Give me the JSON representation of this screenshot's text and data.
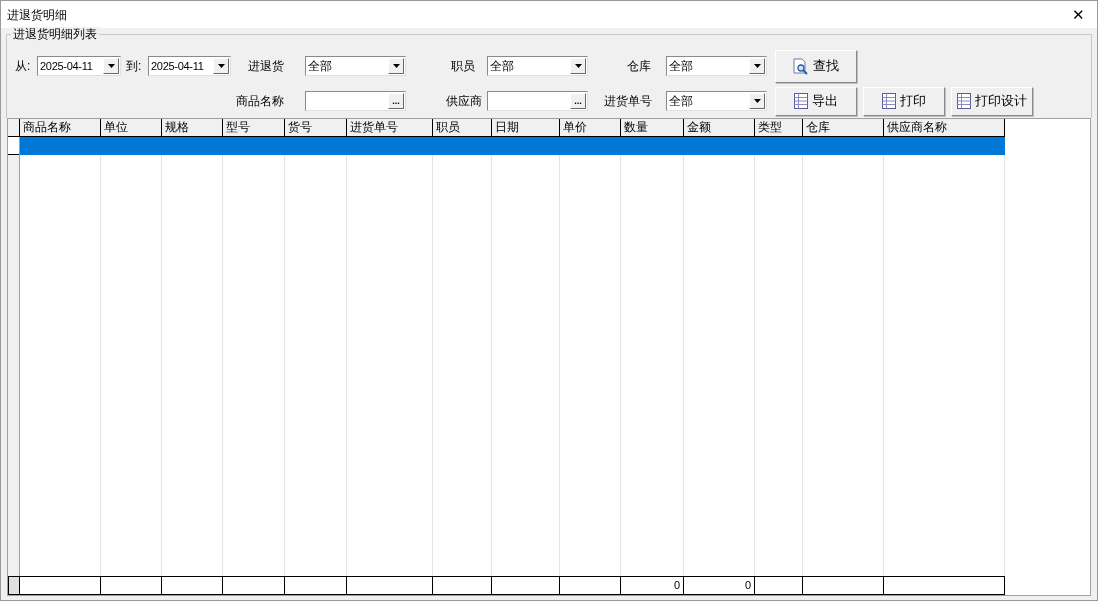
{
  "window": {
    "title": "进退货明细",
    "close": "✕"
  },
  "group_title": "进退货明细列表",
  "filter_rows": [
    [
      {
        "kind": "date",
        "label": "从:",
        "value": "2025-04-11"
      },
      {
        "kind": "date",
        "label": "到:",
        "value": "2025-04-11"
      },
      {
        "kind": "combo",
        "label": "进退货",
        "value": "全部"
      },
      {
        "kind": "combo",
        "label": "职员",
        "value": "全部"
      },
      {
        "kind": "combo",
        "label": "仓库",
        "value": "全部"
      }
    ],
    [
      {
        "kind": "lookup",
        "label": "商品名称",
        "button": "..."
      },
      {
        "kind": "lookup",
        "label": "供应商",
        "button": "..."
      },
      {
        "kind": "combo",
        "label": "进货单号",
        "value": "全部"
      }
    ]
  ],
  "buttons": [
    {
      "label": "查找",
      "kind": "search"
    },
    {
      "label": "导出",
      "kind": "sheet"
    },
    {
      "label": "打印",
      "kind": "sheet"
    },
    {
      "label": "打印设计",
      "kind": "sheet"
    }
  ],
  "table": {
    "columns": [
      "商品名称",
      "单位",
      "规格",
      "型号",
      "货号",
      "进货单号",
      "职员",
      "日期",
      "单价",
      "数量",
      "金额",
      "类型",
      "仓库",
      "供应商名称"
    ],
    "rows": [
      {
        "selected": true
      }
    ],
    "totals": {
      "quantity": "0",
      "amount": "0"
    }
  }
}
